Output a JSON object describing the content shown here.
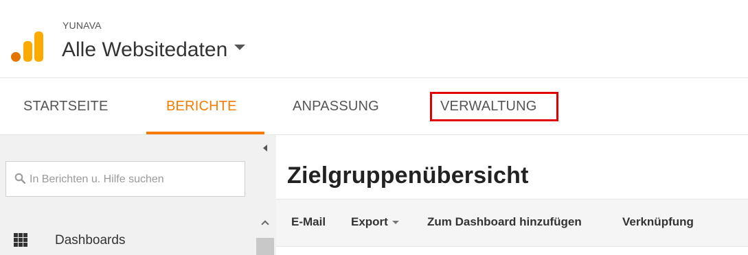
{
  "header": {
    "account_name": "YUNAVA",
    "property_name": "Alle Websitedaten",
    "logo_colors": [
      "#e37400",
      "#f9ab00",
      "#f9ab00"
    ]
  },
  "tabs": [
    {
      "label": "STARTSEITE",
      "active": false
    },
    {
      "label": "BERICHTE",
      "active": true
    },
    {
      "label": "ANPASSUNG",
      "active": false
    },
    {
      "label": "VERWALTUNG",
      "active": false,
      "highlighted": true
    }
  ],
  "colors": {
    "accent": "#f57c00",
    "highlight_border": "#e00000"
  },
  "sidebar": {
    "search_placeholder": "In Berichten u. Hilfe suchen",
    "items": [
      {
        "label": "Dashboards",
        "icon": "grid-icon"
      }
    ]
  },
  "main": {
    "title": "Zielgruppenübersicht",
    "toolbar": {
      "email": "E-Mail",
      "export": "Export",
      "add_dashboard": "Zum Dashboard hinzufügen",
      "shortcut": "Verknüpfung"
    }
  }
}
